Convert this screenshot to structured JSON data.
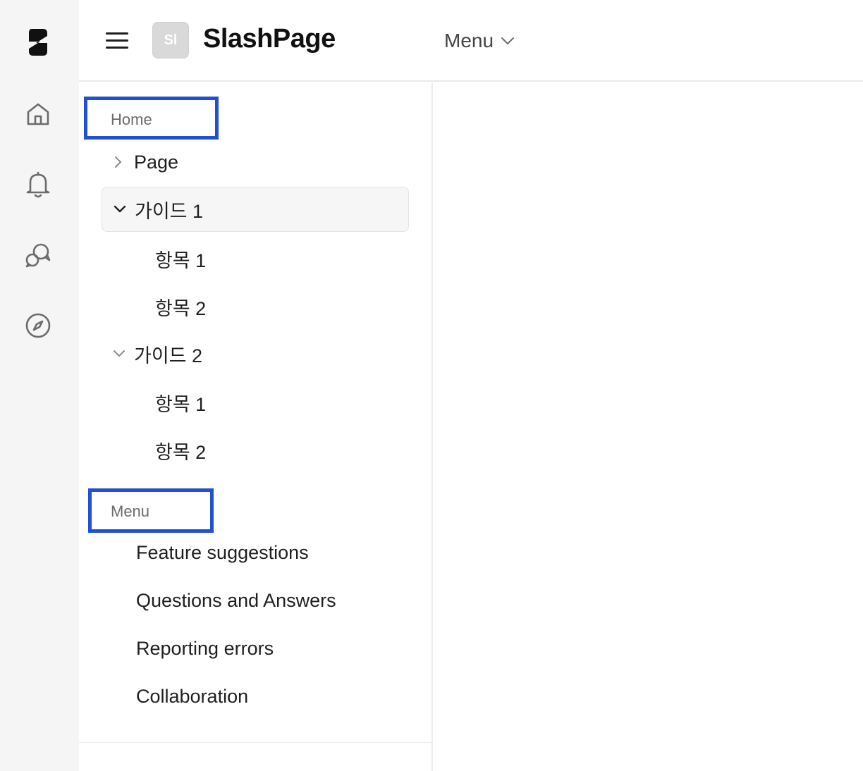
{
  "header": {
    "workspace_initials": "Sl",
    "site_title": "SlashPage",
    "menu_label": "Menu"
  },
  "rail": {
    "icons": [
      "slash-logo-icon",
      "home-icon",
      "bell-icon",
      "chat-icon",
      "compass-icon"
    ]
  },
  "sidebar": {
    "home_section": {
      "label": "Home",
      "items": [
        {
          "label": "Page",
          "expanded": false
        },
        {
          "label": "가이드 1",
          "expanded": true,
          "active": true,
          "children": [
            "항목 1",
            "항목 2"
          ]
        },
        {
          "label": "가이드 2",
          "expanded": true,
          "children": [
            "항목 1",
            "항목 2"
          ]
        }
      ]
    },
    "menu_section": {
      "label": "Menu",
      "items": [
        "Feature suggestions",
        "Questions and Answers",
        "Reporting errors",
        "Collaboration"
      ]
    }
  },
  "colors": {
    "highlight_box": "#2150d3",
    "rail_background": "#f5f5f5"
  }
}
